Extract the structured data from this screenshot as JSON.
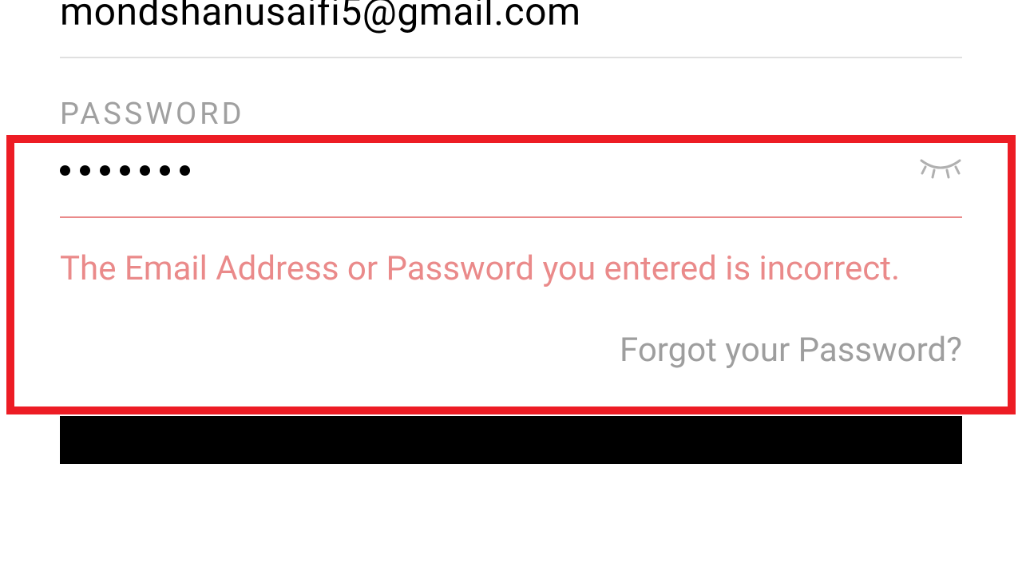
{
  "email": {
    "value": "mondshanusaifi5@gmail.com"
  },
  "password": {
    "label": "PASSWORD",
    "dot_count": 7,
    "error_message": "The Email Address or Password you entered is incorrect."
  },
  "links": {
    "forgot_password": "Forgot your Password?"
  },
  "colors": {
    "error": "#ea8a8a",
    "highlight": "#ed1c24",
    "muted": "#a0a0a0"
  }
}
